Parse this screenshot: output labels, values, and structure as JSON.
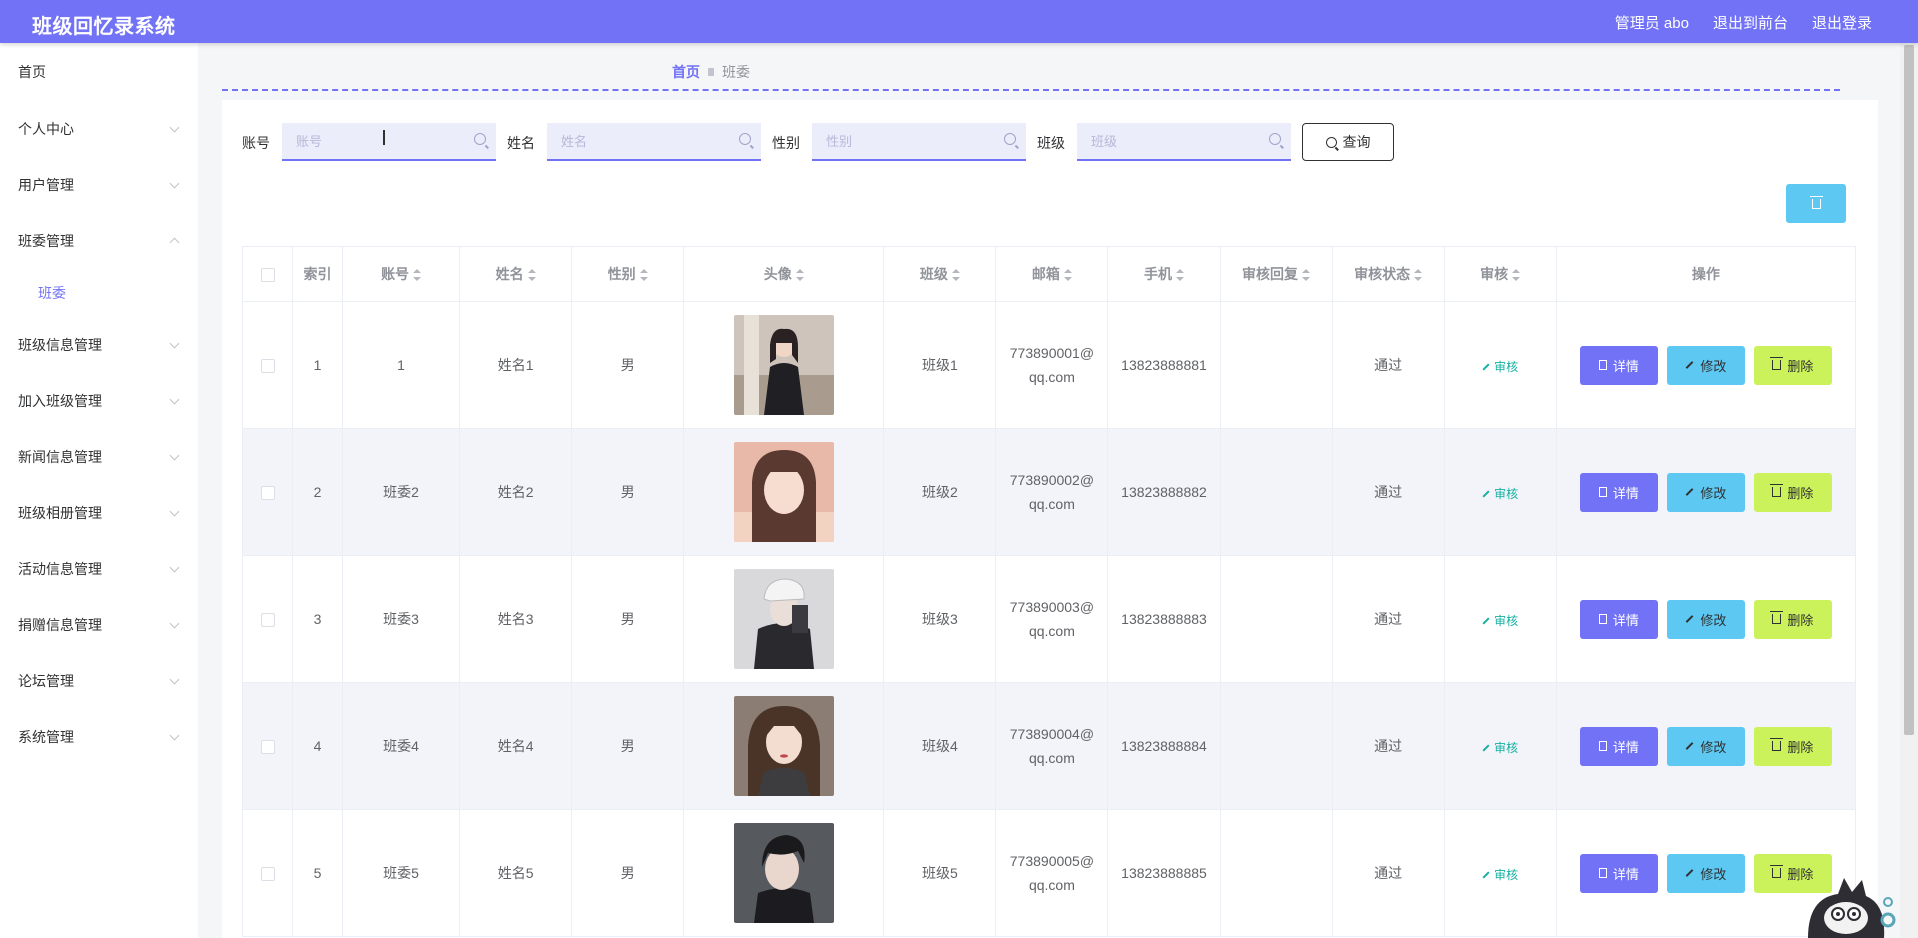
{
  "header": {
    "title": "班级回忆录系统",
    "user_label": "管理员 abo",
    "front_label": "退出到前台",
    "logout_label": "退出登录"
  },
  "sidebar": {
    "items": [
      {
        "label": "首页"
      },
      {
        "label": "个人中心"
      },
      {
        "label": "用户管理"
      },
      {
        "label": "班委管理"
      },
      {
        "label": "班级信息管理"
      },
      {
        "label": "加入班级管理"
      },
      {
        "label": "新闻信息管理"
      },
      {
        "label": "班级相册管理"
      },
      {
        "label": "活动信息管理"
      },
      {
        "label": "捐赠信息管理"
      },
      {
        "label": "论坛管理"
      },
      {
        "label": "系统管理"
      }
    ],
    "sub_label": "班委"
  },
  "breadcrumb": {
    "home": "首页",
    "current": "班委"
  },
  "search": {
    "account_label": "账号",
    "account_placeholder": "账号",
    "name_label": "姓名",
    "name_placeholder": "姓名",
    "gender_label": "性别",
    "gender_placeholder": "性别",
    "class_label": "班级",
    "class_placeholder": "班级",
    "query_label": "查询"
  },
  "table": {
    "headers": [
      "索引",
      "账号",
      "姓名",
      "性别",
      "头像",
      "班级",
      "邮箱",
      "手机",
      "审核回复",
      "审核状态",
      "审核",
      "操作"
    ],
    "review_label": "审核",
    "detail_label": "详情",
    "edit_label": "修改",
    "delete_label": "删除",
    "rows": [
      {
        "index": "1",
        "account": "1",
        "name": "姓名1",
        "gender": "男",
        "class": "班级1",
        "email_1": "773890001@",
        "email_2": "qq.com",
        "phone": "13823888881",
        "reply": "",
        "status": "通过"
      },
      {
        "index": "2",
        "account": "班委2",
        "name": "姓名2",
        "gender": "男",
        "class": "班级2",
        "email_1": "773890002@",
        "email_2": "qq.com",
        "phone": "13823888882",
        "reply": "",
        "status": "通过"
      },
      {
        "index": "3",
        "account": "班委3",
        "name": "姓名3",
        "gender": "男",
        "class": "班级3",
        "email_1": "773890003@",
        "email_2": "qq.com",
        "phone": "13823888883",
        "reply": "",
        "status": "通过"
      },
      {
        "index": "4",
        "account": "班委4",
        "name": "姓名4",
        "gender": "男",
        "class": "班级4",
        "email_1": "773890004@",
        "email_2": "qq.com",
        "phone": "13823888884",
        "reply": "",
        "status": "通过"
      },
      {
        "index": "5",
        "account": "班委5",
        "name": "姓名5",
        "gender": "男",
        "class": "班级5",
        "email_1": "773890005@",
        "email_2": "qq.com",
        "phone": "13823888885",
        "reply": "",
        "status": "通过"
      }
    ]
  },
  "colors": {
    "primary": "#7272f6",
    "info": "#5dc8f1",
    "lime": "#cbf25a",
    "teal": "#16b0a2"
  }
}
